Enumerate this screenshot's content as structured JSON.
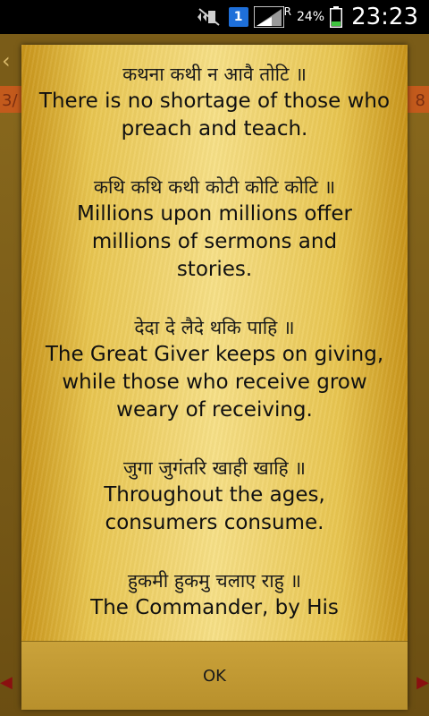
{
  "status_bar": {
    "notification_count": "1",
    "roaming": "R",
    "battery_percent": "24%",
    "time": "23:23",
    "icons": [
      "mute-vibrate-icon",
      "notification-icon",
      "signal-icon",
      "battery-icon"
    ]
  },
  "background": {
    "back_chevron": "‹",
    "page_left": "3/",
    "page_right": "8",
    "prev_arrow": "◀",
    "next_arrow": "▶"
  },
  "verses": [
    {
      "gurmukhi": "कथना कथी न आवै तोटि ॥",
      "english": "There is no shortage of those who preach and teach."
    },
    {
      "gurmukhi": "कथि कथि कथी कोटी कोटि कोटि ॥",
      "english": "Millions upon millions offer millions of sermons and stories."
    },
    {
      "gurmukhi": "देदा दे लैदे थकि पाहि ॥",
      "english": "The Great Giver keeps on giving, while those who receive grow weary of receiving."
    },
    {
      "gurmukhi": "जुगा जुगंतरि खाही खाहि ॥",
      "english": "Throughout the ages, consumers consume."
    },
    {
      "gurmukhi": "हुकमी हुकमु चलाए राहु ॥",
      "english": "The Commander, by His"
    }
  ],
  "dialog": {
    "ok_label": "OK"
  },
  "colors": {
    "dialog_gold": "#f6df86",
    "footer_gold": "#caa23a",
    "subbar_orange": "#c35a1c"
  }
}
